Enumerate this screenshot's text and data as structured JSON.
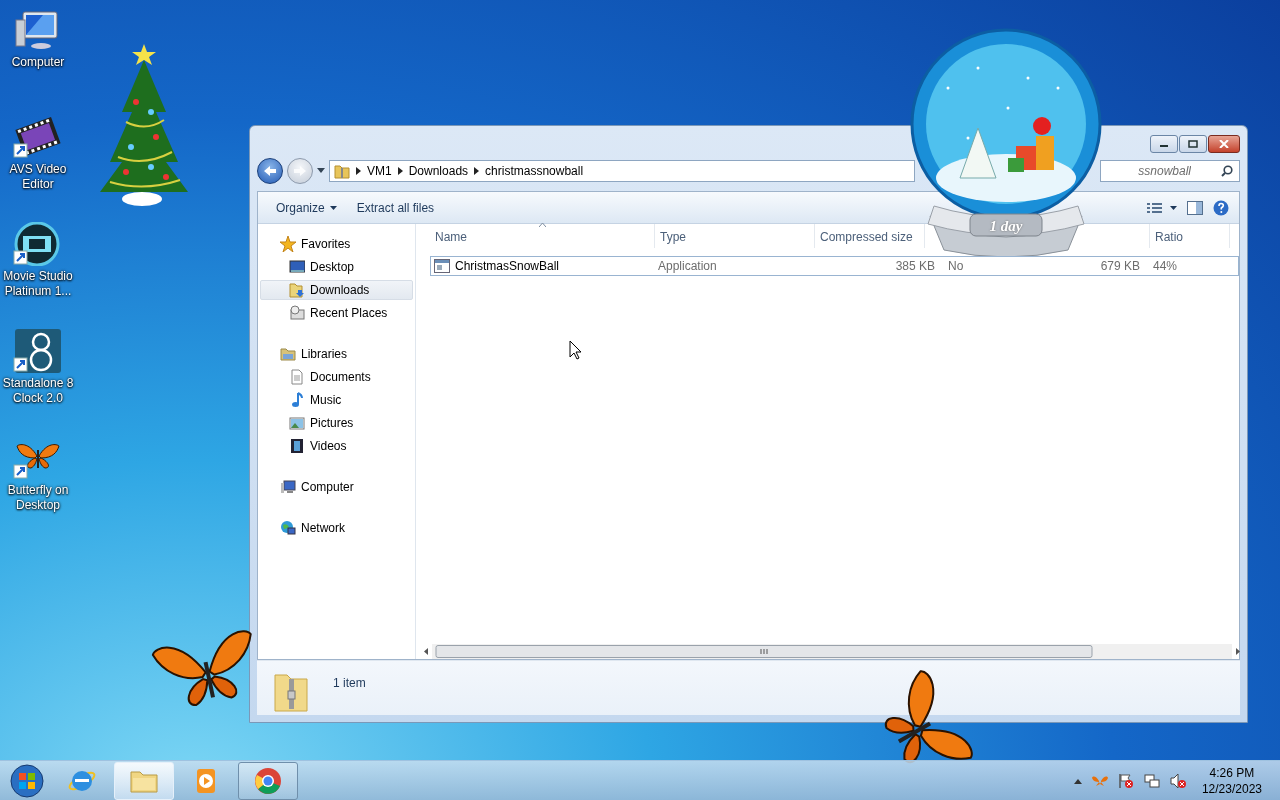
{
  "desktop_icons": [
    {
      "label": "Computer",
      "shortcut": false
    },
    {
      "label": "AVS Video Editor",
      "shortcut": true
    },
    {
      "label": "Movie Studio Platinum 1...",
      "shortcut": true
    },
    {
      "label": "Standalone 8 Clock 2.0",
      "shortcut": true
    },
    {
      "label": "Butterfly on Desktop",
      "shortcut": true
    }
  ],
  "explorer": {
    "breadcrumb": [
      "VM1",
      "Downloads",
      "christmassnowball"
    ],
    "search": {
      "value": "ssnowball"
    },
    "toolbar": [
      {
        "label": "Organize",
        "dropdown": true
      },
      {
        "label": "Extract all files",
        "dropdown": false
      }
    ],
    "nav": [
      {
        "label": "Favorites",
        "selected": false,
        "children": [
          {
            "label": "Desktop",
            "selected": false
          },
          {
            "label": "Downloads",
            "selected": true
          },
          {
            "label": "Recent Places",
            "selected": false
          }
        ]
      },
      {
        "label": "Libraries",
        "selected": false,
        "children": [
          {
            "label": "Documents",
            "selected": false
          },
          {
            "label": "Music",
            "selected": false
          },
          {
            "label": "Pictures",
            "selected": false
          },
          {
            "label": "Videos",
            "selected": false
          }
        ]
      },
      {
        "label": "Computer",
        "selected": false
      },
      {
        "label": "Network",
        "selected": false
      }
    ],
    "columns": [
      {
        "label": "Name",
        "sorted": true
      },
      {
        "label": "Type",
        "sorted": false
      },
      {
        "label": "Compressed size",
        "sorted": false
      },
      null,
      null,
      {
        "label": "Ratio",
        "sorted": false
      }
    ],
    "rows": [
      {
        "cells": [
          "ChristmasSnowBall",
          "Application",
          "385 KB",
          "No",
          "679 KB",
          "44%"
        ],
        "focused": true,
        "selected": false
      }
    ],
    "status": "1 item"
  },
  "snow_globe": {
    "label": "1 day"
  },
  "taskbar": {
    "items": [
      {
        "running": false,
        "active": false
      },
      {
        "running": true,
        "active": true
      },
      {
        "running": false,
        "active": false
      },
      {
        "running": true,
        "active": false
      }
    ],
    "time": "4:26 PM",
    "date": "12/23/2023"
  }
}
